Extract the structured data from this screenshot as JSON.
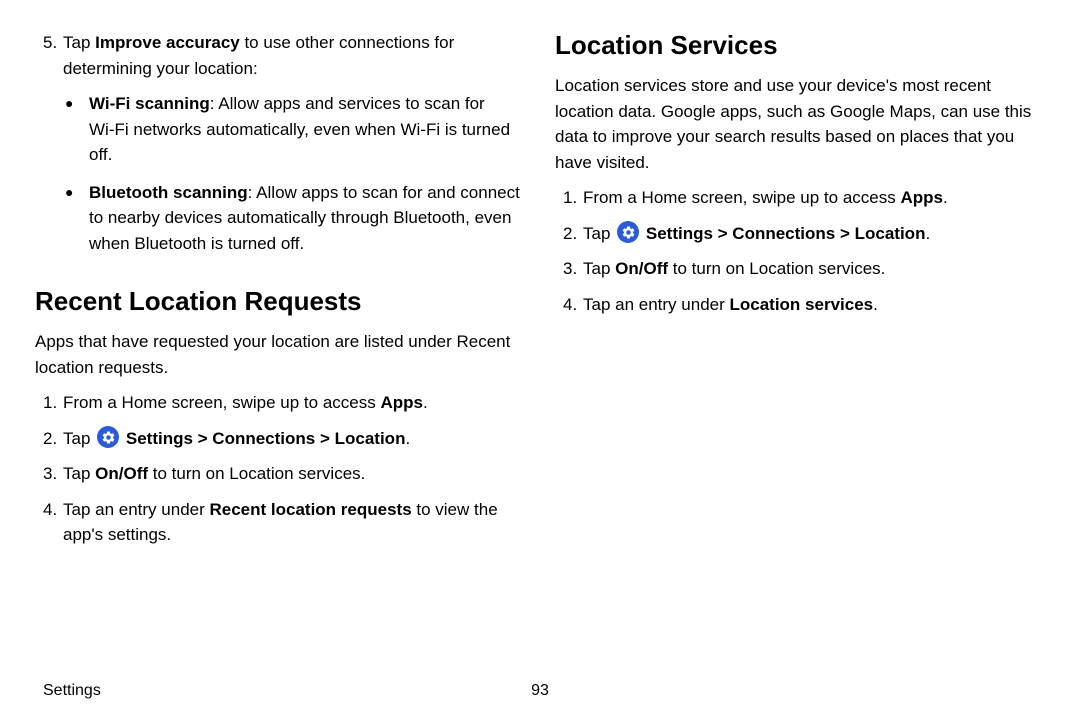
{
  "left": {
    "item5": {
      "num": "5.",
      "pre": "Tap ",
      "bold": "Improve accuracy",
      "post": " to use other connections for determining your location:"
    },
    "wifi": {
      "bold": "Wi‑Fi scanning",
      "rest": ": Allow apps and services to scan for Wi‑Fi networks automatically, even when Wi‑Fi is turned off."
    },
    "bt": {
      "bold": "Bluetooth scanning",
      "rest": ": Allow apps to scan for and connect to nearby devices automatically through Bluetooth, even when Bluetooth is turned off."
    },
    "heading": "Recent Location Requests",
    "intro": "Apps that have requested your location are listed under Recent location requests.",
    "step1": {
      "num": "1.",
      "pre": "From a Home screen, swipe up to access ",
      "bold": "Apps",
      "post": "."
    },
    "step2": {
      "num": "2.",
      "pre": "Tap ",
      "path": " Settings > Connections > Location",
      "post": "."
    },
    "step3": {
      "num": "3.",
      "pre": "Tap ",
      "bold": "On/Off",
      "post": " to turn on Location services."
    },
    "step4": {
      "num": "4.",
      "pre": "Tap an entry under ",
      "bold": "Recent location requests",
      "post": " to view the app's settings."
    }
  },
  "right": {
    "heading": "Location Services",
    "intro": "Location services store and use your device's most recent location data. Google apps, such as Google Maps, can use this data to improve your search results based on places that you have visited.",
    "step1": {
      "num": "1.",
      "pre": "From a Home screen, swipe up to access ",
      "bold": "Apps",
      "post": "."
    },
    "step2": {
      "num": "2.",
      "pre": "Tap ",
      "path": " Settings > Connections > Location",
      "post": "."
    },
    "step3": {
      "num": "3.",
      "pre": "Tap ",
      "bold": "On/Off",
      "post": " to turn on Location services."
    },
    "step4": {
      "num": "4.",
      "pre": "Tap an entry under ",
      "bold": "Location services",
      "post": "."
    }
  },
  "footer": {
    "section": "Settings",
    "page": "93"
  }
}
